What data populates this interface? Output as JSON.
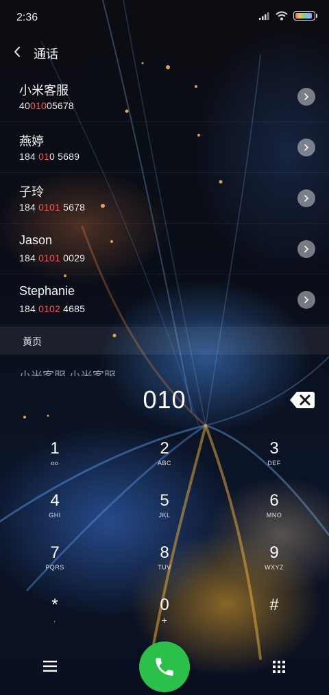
{
  "status_bar": {
    "time": "2:36"
  },
  "header": {
    "title": "通话"
  },
  "contacts": [
    {
      "name": "小米客服",
      "number_pre": "40",
      "number_match": "010",
      "number_post": "05678"
    },
    {
      "name": "燕婷",
      "number_pre": "184 ",
      "number_match": "01",
      "number_post": "0 5689"
    },
    {
      "name": "子玲",
      "number_pre": "184 ",
      "number_match": "0101",
      "number_post": " 5678"
    },
    {
      "name": "Jason",
      "number_pre": "184 ",
      "number_match": "0101",
      "number_post": " 0029"
    },
    {
      "name": "Stephanie",
      "number_pre": "184 ",
      "number_match": "0102",
      "number_post": " 4685"
    }
  ],
  "yellow_pages": {
    "section_title": "黄页",
    "partial_row_text": "小米客服  小米客服"
  },
  "dialer": {
    "input": "010"
  },
  "keypad": [
    {
      "digit": "1",
      "letters": "oo"
    },
    {
      "digit": "2",
      "letters": "ABC"
    },
    {
      "digit": "3",
      "letters": "DEF"
    },
    {
      "digit": "4",
      "letters": "GHI"
    },
    {
      "digit": "5",
      "letters": "JKL"
    },
    {
      "digit": "6",
      "letters": "MNO"
    },
    {
      "digit": "7",
      "letters": "PQRS"
    },
    {
      "digit": "8",
      "letters": "TUV"
    },
    {
      "digit": "9",
      "letters": "WXYZ"
    },
    {
      "digit": "*",
      "letters": ","
    },
    {
      "digit": "0",
      "letters": "+"
    },
    {
      "digit": "#",
      "letters": ""
    }
  ],
  "colors": {
    "highlight": "#f45a5a",
    "call_button": "#2ac04a"
  },
  "icons": {
    "back": "chevron-left-icon",
    "detail": "chevron-right-icon",
    "backspace": "backspace-icon",
    "menu": "hamburger-menu-icon",
    "call": "phone-icon",
    "dialpad": "dialpad-grid-icon"
  }
}
